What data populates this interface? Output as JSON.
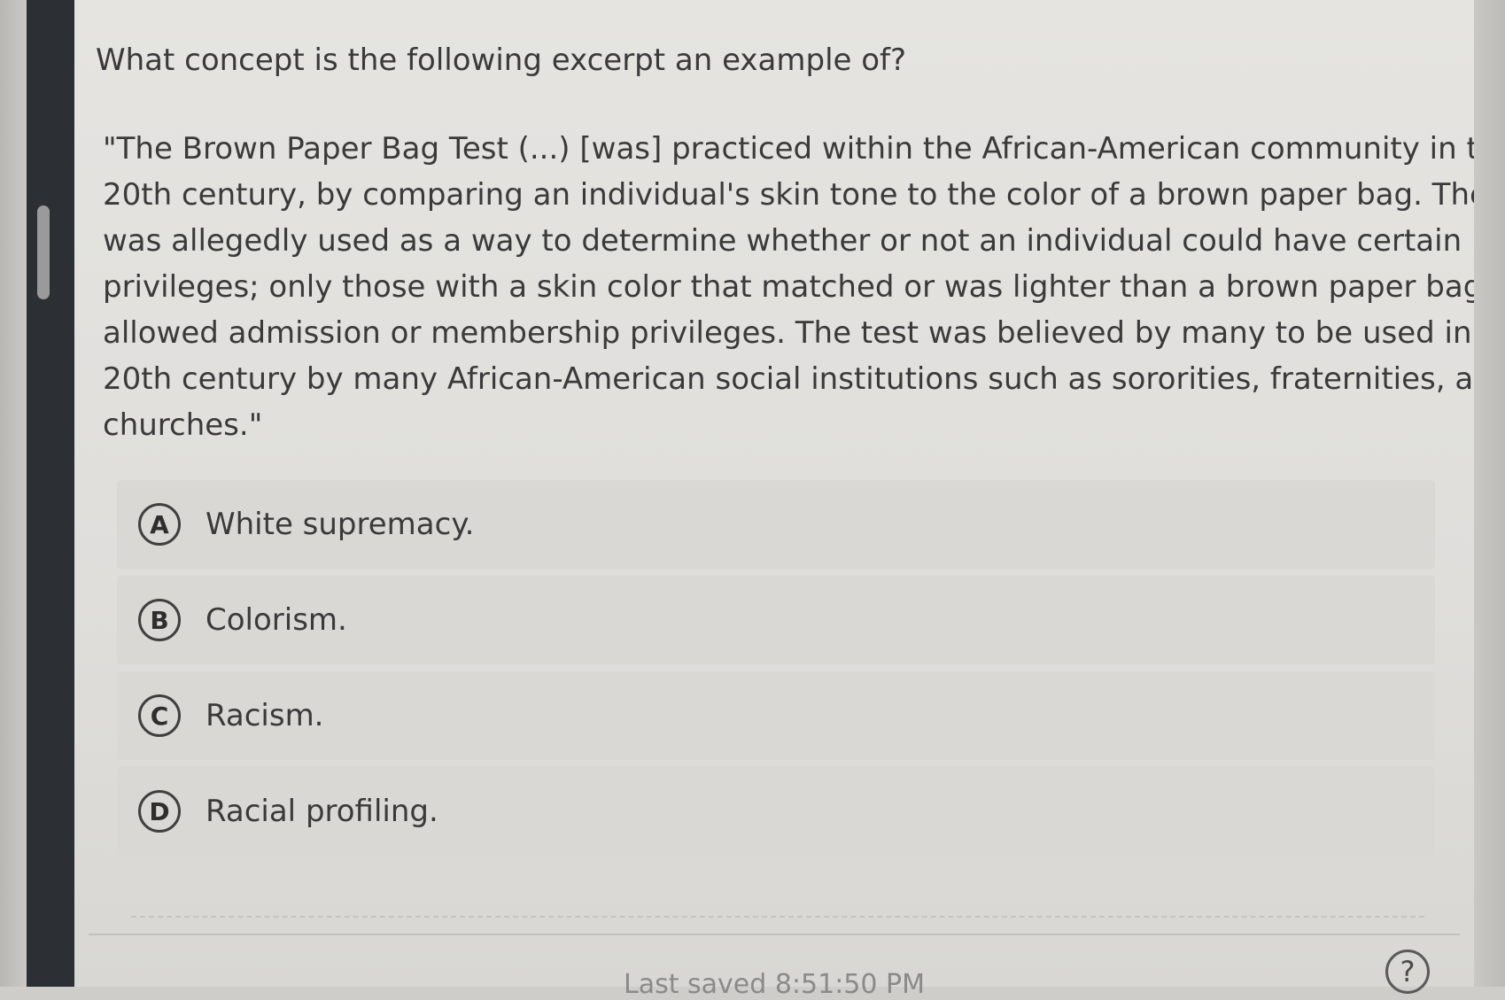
{
  "question": {
    "prompt": "What concept is the following excerpt an example of?",
    "excerpt_lines": [
      "\"The Brown Paper Bag Test (...) [was] practiced within the African-American community in the",
      "20th century, by comparing an individual's skin tone to the color of a brown paper bag. The test",
      "was allegedly used as a way to determine whether or not an individual could have certain",
      "privileges; only those with a skin color that matched or was lighter than a brown paper bag were",
      "allowed admission or membership privileges. The test was believed by many to be used in the",
      "20th century by many African-American social institutions such as sororities, fraternities, and",
      "churches.\""
    ]
  },
  "choices": [
    {
      "letter": "A",
      "label": "White supremacy."
    },
    {
      "letter": "B",
      "label": "Colorism."
    },
    {
      "letter": "C",
      "label": "Racism."
    },
    {
      "letter": "D",
      "label": "Racial profiling."
    }
  ],
  "footer": {
    "last_saved": "Last saved 8:51:50 PM",
    "help_icon": "question-mark-icon"
  },
  "colors": {
    "text": "#3a3a3a",
    "choice_background": "#d9d8d4",
    "frame_bar": "#2c2f33"
  }
}
